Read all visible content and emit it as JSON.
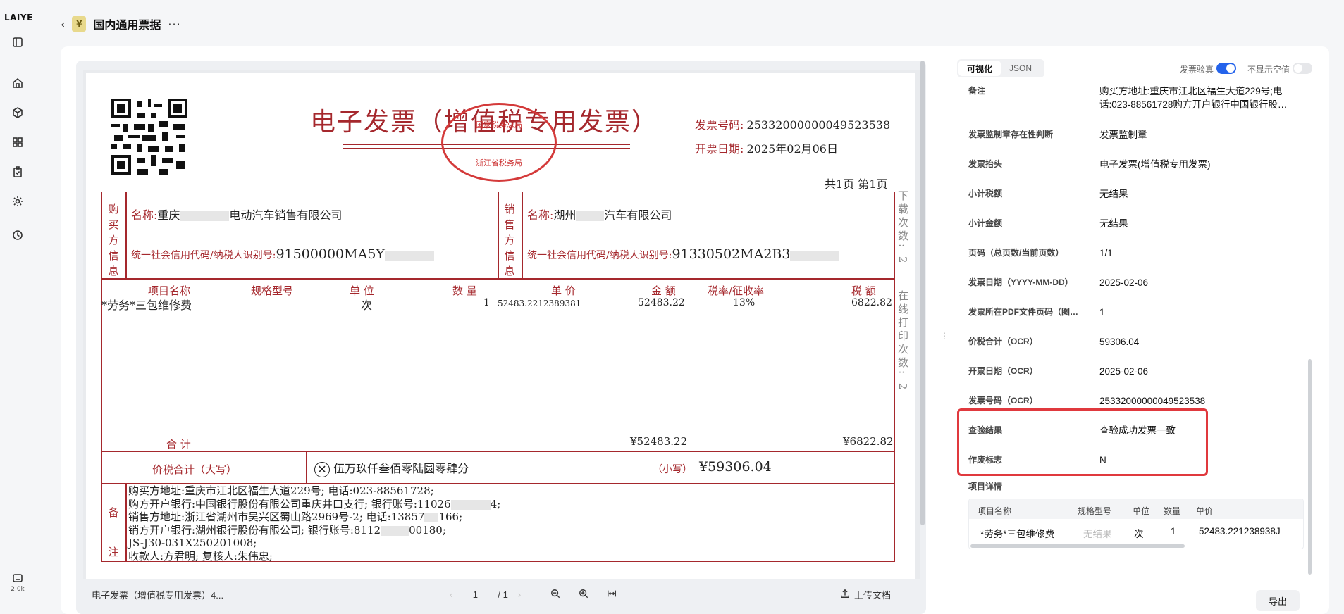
{
  "app": {
    "logo": "LAIYE",
    "storage": "2.0k"
  },
  "header": {
    "back": "‹",
    "doc_icon": "¥",
    "title": "国内通用票据",
    "more": "···"
  },
  "invoice": {
    "title": "电子发票（增值税专用发票）",
    "seal_top": "国家税务总局",
    "seal_bottom": "浙江省税务局",
    "number_label": "发票号码:",
    "number": "25332000000049523538",
    "date_label": "开票日期:",
    "date": "2025年02月06日",
    "pages": "共1页  第1页",
    "side_download": "下载次数: 2",
    "side_print": "在线打印次数: 2",
    "buyer_label": "购买方信息",
    "buyer_name_label": "名称:",
    "buyer_name_a": "重庆",
    "buyer_name_b": "电动汽车销售有限公司",
    "buyer_tax_label": "统一社会信用代码/纳税人识别号:",
    "buyer_tax": "91500000MA5Y",
    "seller_label": "销售方信息",
    "seller_name_label": "名称:",
    "seller_name_a": "湖州",
    "seller_name_b": "汽车有限公司",
    "seller_tax_label": "统一社会信用代码/纳税人识别号:",
    "seller_tax": "91330502MA2B3",
    "columns": [
      "项目名称",
      "规格型号",
      "单  位",
      "数  量",
      "单  价",
      "金  额",
      "税率/征收率",
      "税  额"
    ],
    "item": {
      "name": "*劳务*三包维修费",
      "unit": "次",
      "qty": "1",
      "price": "52483.2212389381",
      "amount": "52483.22",
      "rate": "13%",
      "tax": "6822.82"
    },
    "total_label": "合      计",
    "total_amount": "¥52483.22",
    "total_tax": "¥6822.82",
    "grand_label": "价税合计（大写）",
    "grand_upper": "伍万玖仟叁佰零陆圆零肆分",
    "grand_small_label": "（小写）",
    "grand_small": "¥59306.04",
    "remark_label": "备注",
    "remarks": [
      "购买方地址:重庆市江北区福生大道229号;     电话:023-88561728;",
      "购方开户银行:中国银行股份有限公司重庆井口支行;     银行账号:11026",
      "销售方地址:浙江省湖州市吴兴区蜀山路2969号-2;     电话:13857",
      "销方开户银行:湖州银行股份有限公司;     银行账号:8112",
      "JS-J30-031X250201008;",
      "收款人:方君明;     复核人:朱伟忠;"
    ],
    "remark_tails": [
      "",
      "4;",
      "166;",
      "00180;",
      "",
      ""
    ]
  },
  "viewer": {
    "filename": "电子发票（增值税专用发票）4...",
    "page_current": "1",
    "page_total": "/ 1",
    "upload": "上传文档"
  },
  "right": {
    "tab_visual": "可视化",
    "tab_json": "JSON",
    "verify_label": "发票验真",
    "hide_empty_label": "不显示空值",
    "fields": [
      {
        "k": "备注",
        "v": "购买方地址:重庆市江北区福生大道229号;电话:023-88561728购方开户银行中国银行股…"
      },
      {
        "k": "发票监制章存在性判断",
        "v": "发票监制章"
      },
      {
        "k": "发票抬头",
        "v": "电子发票(增值税专用发票)"
      },
      {
        "k": "小计税额",
        "v": "无结果"
      },
      {
        "k": "小计金额",
        "v": "无结果"
      },
      {
        "k": "页码（总页数/当前页数）",
        "v": "1/1"
      },
      {
        "k": "发票日期（YYYY-MM-DD）",
        "v": "2025-02-06"
      },
      {
        "k": "发票所在PDF文件页码（图…",
        "v": "1"
      },
      {
        "k": "价税合计（OCR）",
        "v": "59306.04"
      },
      {
        "k": "开票日期（OCR）",
        "v": "2025-02-06"
      },
      {
        "k": "发票号码（OCR）",
        "v": "25332000000049523538"
      },
      {
        "k": "查验结果",
        "v": "查验成功发票一致"
      },
      {
        "k": "作废标志",
        "v": "N"
      }
    ],
    "items_title": "项目详情",
    "items_headers": [
      "项目名称",
      "规格型号",
      "单位",
      "数量",
      "单价"
    ],
    "items_row": [
      "*劳务*三包维修费",
      "无结果",
      "次",
      "1",
      "52483.221238938J"
    ],
    "export": "导出"
  }
}
